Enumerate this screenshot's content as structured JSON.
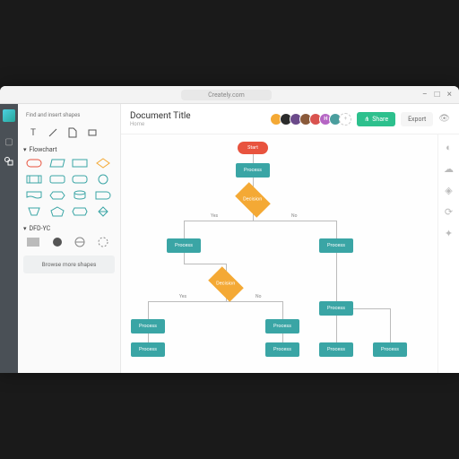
{
  "url": "Creately.com",
  "doc": {
    "title": "Document Title",
    "breadcrumb": "Home"
  },
  "actions": {
    "share": "Share",
    "export": "Export"
  },
  "search": {
    "placeholder": "Find and insert shapes"
  },
  "sections": {
    "flowchart": "Flowchart",
    "dfd": "DFD-YC"
  },
  "browse": "Browse more shapes",
  "avatars": [
    {
      "bg": "#f4a935"
    },
    {
      "bg": "#2b2b2b"
    },
    {
      "bg": "#6b4a8a"
    },
    {
      "bg": "#8a5a3a"
    },
    {
      "bg": "#d9534f"
    },
    {
      "bg": "#b565c4",
      "txt": "H"
    },
    {
      "bg": "#4a9e9e"
    }
  ],
  "flow": {
    "start": "Start",
    "process": "Process",
    "decision": "Decision",
    "yes": "Yes",
    "no": "No"
  }
}
